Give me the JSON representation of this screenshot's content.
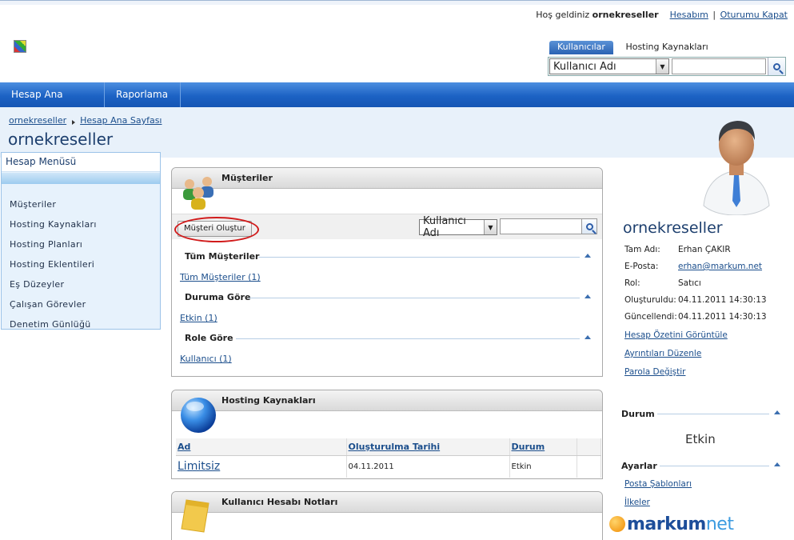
{
  "header": {
    "welcome_prefix": "Hoş geldiniz",
    "username": "ornekreseller",
    "account_link": "Hesabım",
    "separator": "|",
    "logout_link": "Oturumu Kapat"
  },
  "search": {
    "tabs": [
      "Kullanıcılar",
      "Hosting Kaynakları"
    ],
    "field_value": "Kullanıcı Adı"
  },
  "nav": {
    "items": [
      "Hesap Ana Sayfası",
      "Raporlama"
    ]
  },
  "breadcrumb": {
    "items": [
      "ornekreseller",
      "Hesap Ana Sayfası"
    ]
  },
  "page_title": "ornekreseller",
  "left_menu": {
    "title": "Hesap Menüsü",
    "items": [
      "Müşteriler",
      "Hosting Kaynakları",
      "Hosting Planları",
      "Hosting Eklentileri",
      "Eş Düzeyler",
      "Çalışan Görevler",
      "Denetim Günlüğü"
    ]
  },
  "customers_panel": {
    "title": "Müşteriler",
    "create_button": "Müşteri Oluştur",
    "filter_value": "Kullanıcı Adı",
    "groups": [
      {
        "title": "Tüm Müşteriler",
        "link": "Tüm Müşteriler (1)"
      },
      {
        "title": "Duruma Göre",
        "link": "Etkin (1)"
      },
      {
        "title": "Role Göre",
        "link": "Kullanıcı (1)"
      }
    ]
  },
  "hosting_panel": {
    "title": "Hosting Kaynakları",
    "columns": [
      "Ad",
      "Oluşturulma Tarihi",
      "Durum"
    ],
    "rows": [
      {
        "name": "Limitsiz",
        "created": "04.11.2011",
        "status": "Etkin"
      }
    ]
  },
  "notes_panel": {
    "title": "Kullanıcı Hesabı Notları"
  },
  "profile": {
    "name": "ornekreseller",
    "fields": [
      {
        "label": "Tam Adı:",
        "value": "Erhan ÇAKIR"
      },
      {
        "label": "E-Posta:",
        "value": "erhan@markum.net"
      },
      {
        "label": "Rol:",
        "value": "Satıcı"
      },
      {
        "label": "Oluşturuldu:",
        "value": "04.11.2011 14:30:13"
      },
      {
        "label": "Güncellendi:",
        "value": "04.11.2011 14:30:13"
      }
    ],
    "links": [
      "Hesap Özetini Görüntüle",
      "Ayrıntıları Düzenle",
      "Parola Değiştir"
    ],
    "status_title": "Durum",
    "status_value": "Etkin",
    "settings_title": "Ayarlar",
    "settings_links": [
      "Posta Şablonları",
      "İlkeler"
    ]
  },
  "brand": {
    "part1": "markum",
    "part2": "net"
  },
  "colors": {
    "nav": "#1c62c4",
    "accent": "#1d3f6e",
    "link": "#1b4e8c",
    "highlight_ring": "#d11b1b"
  }
}
